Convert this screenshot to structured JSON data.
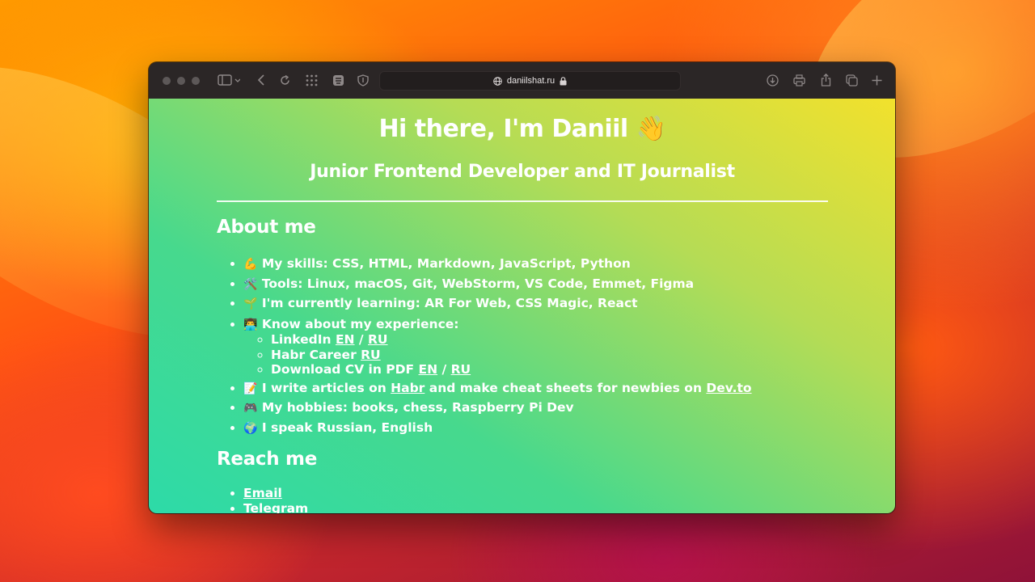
{
  "browser": {
    "url": "daniilshat.ru"
  },
  "page": {
    "title": "Hi there, I'm Daniil 👋",
    "subtitle": "Junior Frontend Developer and IT Journalist",
    "about_heading": "About me",
    "about": {
      "skills_emoji": "💪",
      "skills": "My skills: CSS, HTML, Markdown, JavaScript, Python",
      "tools_emoji": "🛠️",
      "tools": "Tools: Linux, macOS, Git, WebStorm, VS Code, Emmet, Figma",
      "learning_emoji": "🌱",
      "learning": "I'm currently learning: AR For Web, CSS Magic, React",
      "experience_emoji": "👨‍💻",
      "experience": "Know about my experience:",
      "linkedin_label": "LinkedIn",
      "linkedin_en": "EN",
      "linkedin_ru": "RU",
      "habr_career_label": "Habr Career",
      "habr_career_ru": "RU",
      "cv_label": "Download CV in PDF",
      "cv_en": "EN",
      "cv_ru": "RU",
      "slash": "/",
      "articles_emoji": "📝",
      "articles_prefix": "I write articles on",
      "articles_habr": "Habr",
      "articles_middle": "and make cheat sheets for newbies on",
      "articles_devto": "Dev.to",
      "hobbies_emoji": "🎮",
      "hobbies": "My hobbies: books, chess, Raspberry Pi Dev",
      "languages_emoji": "🌍",
      "languages": "I speak Russian, English"
    },
    "reach_heading": "Reach me",
    "reach": {
      "email": "Email",
      "telegram": "Telegram"
    }
  }
}
